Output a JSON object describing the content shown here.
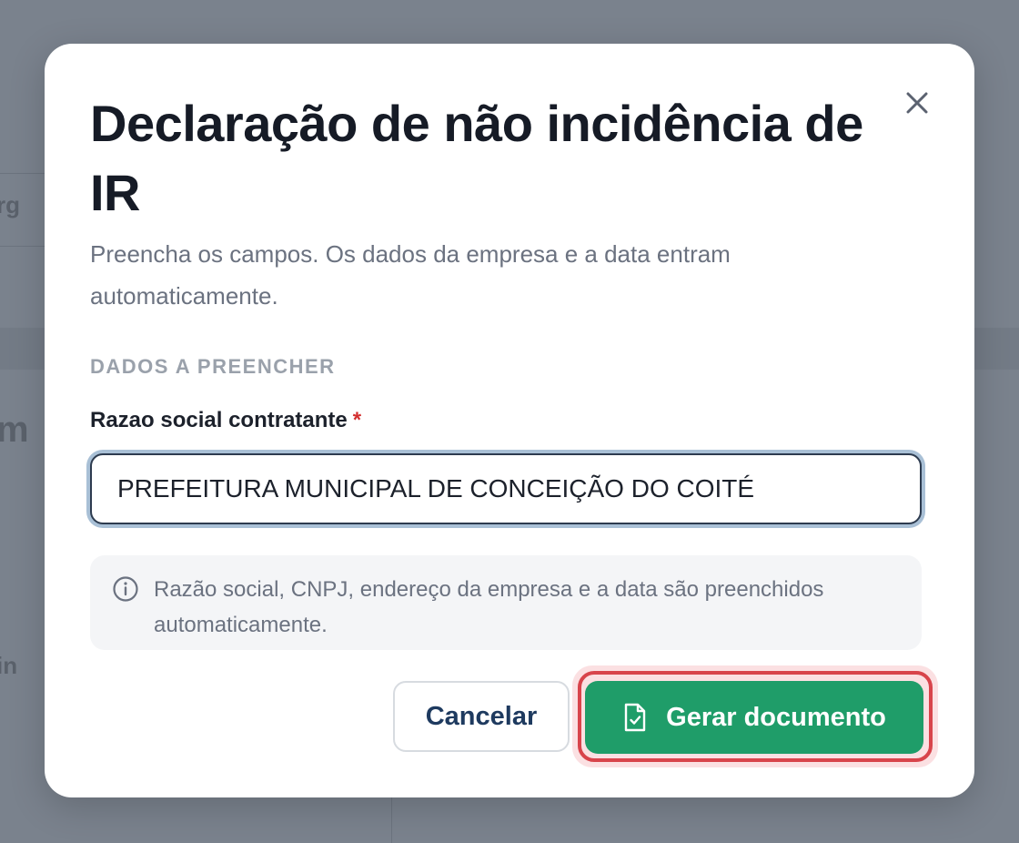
{
  "modal": {
    "title": "Declaração de não incidência de IR",
    "subtitle": "Preencha os campos. Os dados da empresa e a data entram automaticamente.",
    "section_label": "DADOS A PREENCHER",
    "field": {
      "label": "Razao social contratante",
      "required_mark": "*",
      "value": "PREFEITURA MUNICIPAL DE CONCEIÇÃO DO COITÉ"
    },
    "info_text": "Razão social, CNPJ, endereço da empresa e a data são preenchidos automaticamente.",
    "buttons": {
      "cancel_label": "Cancelar",
      "primary_label": "Gerar documento"
    },
    "icons": {
      "close": "close-icon",
      "info": "info-icon",
      "document": "document-check-icon"
    }
  },
  "colors": {
    "primary": "#1f9d69",
    "focus_highlight": "#d8444b",
    "title_text": "#161b26",
    "muted_text": "#6b7280",
    "backdrop": "#7a828d"
  }
}
